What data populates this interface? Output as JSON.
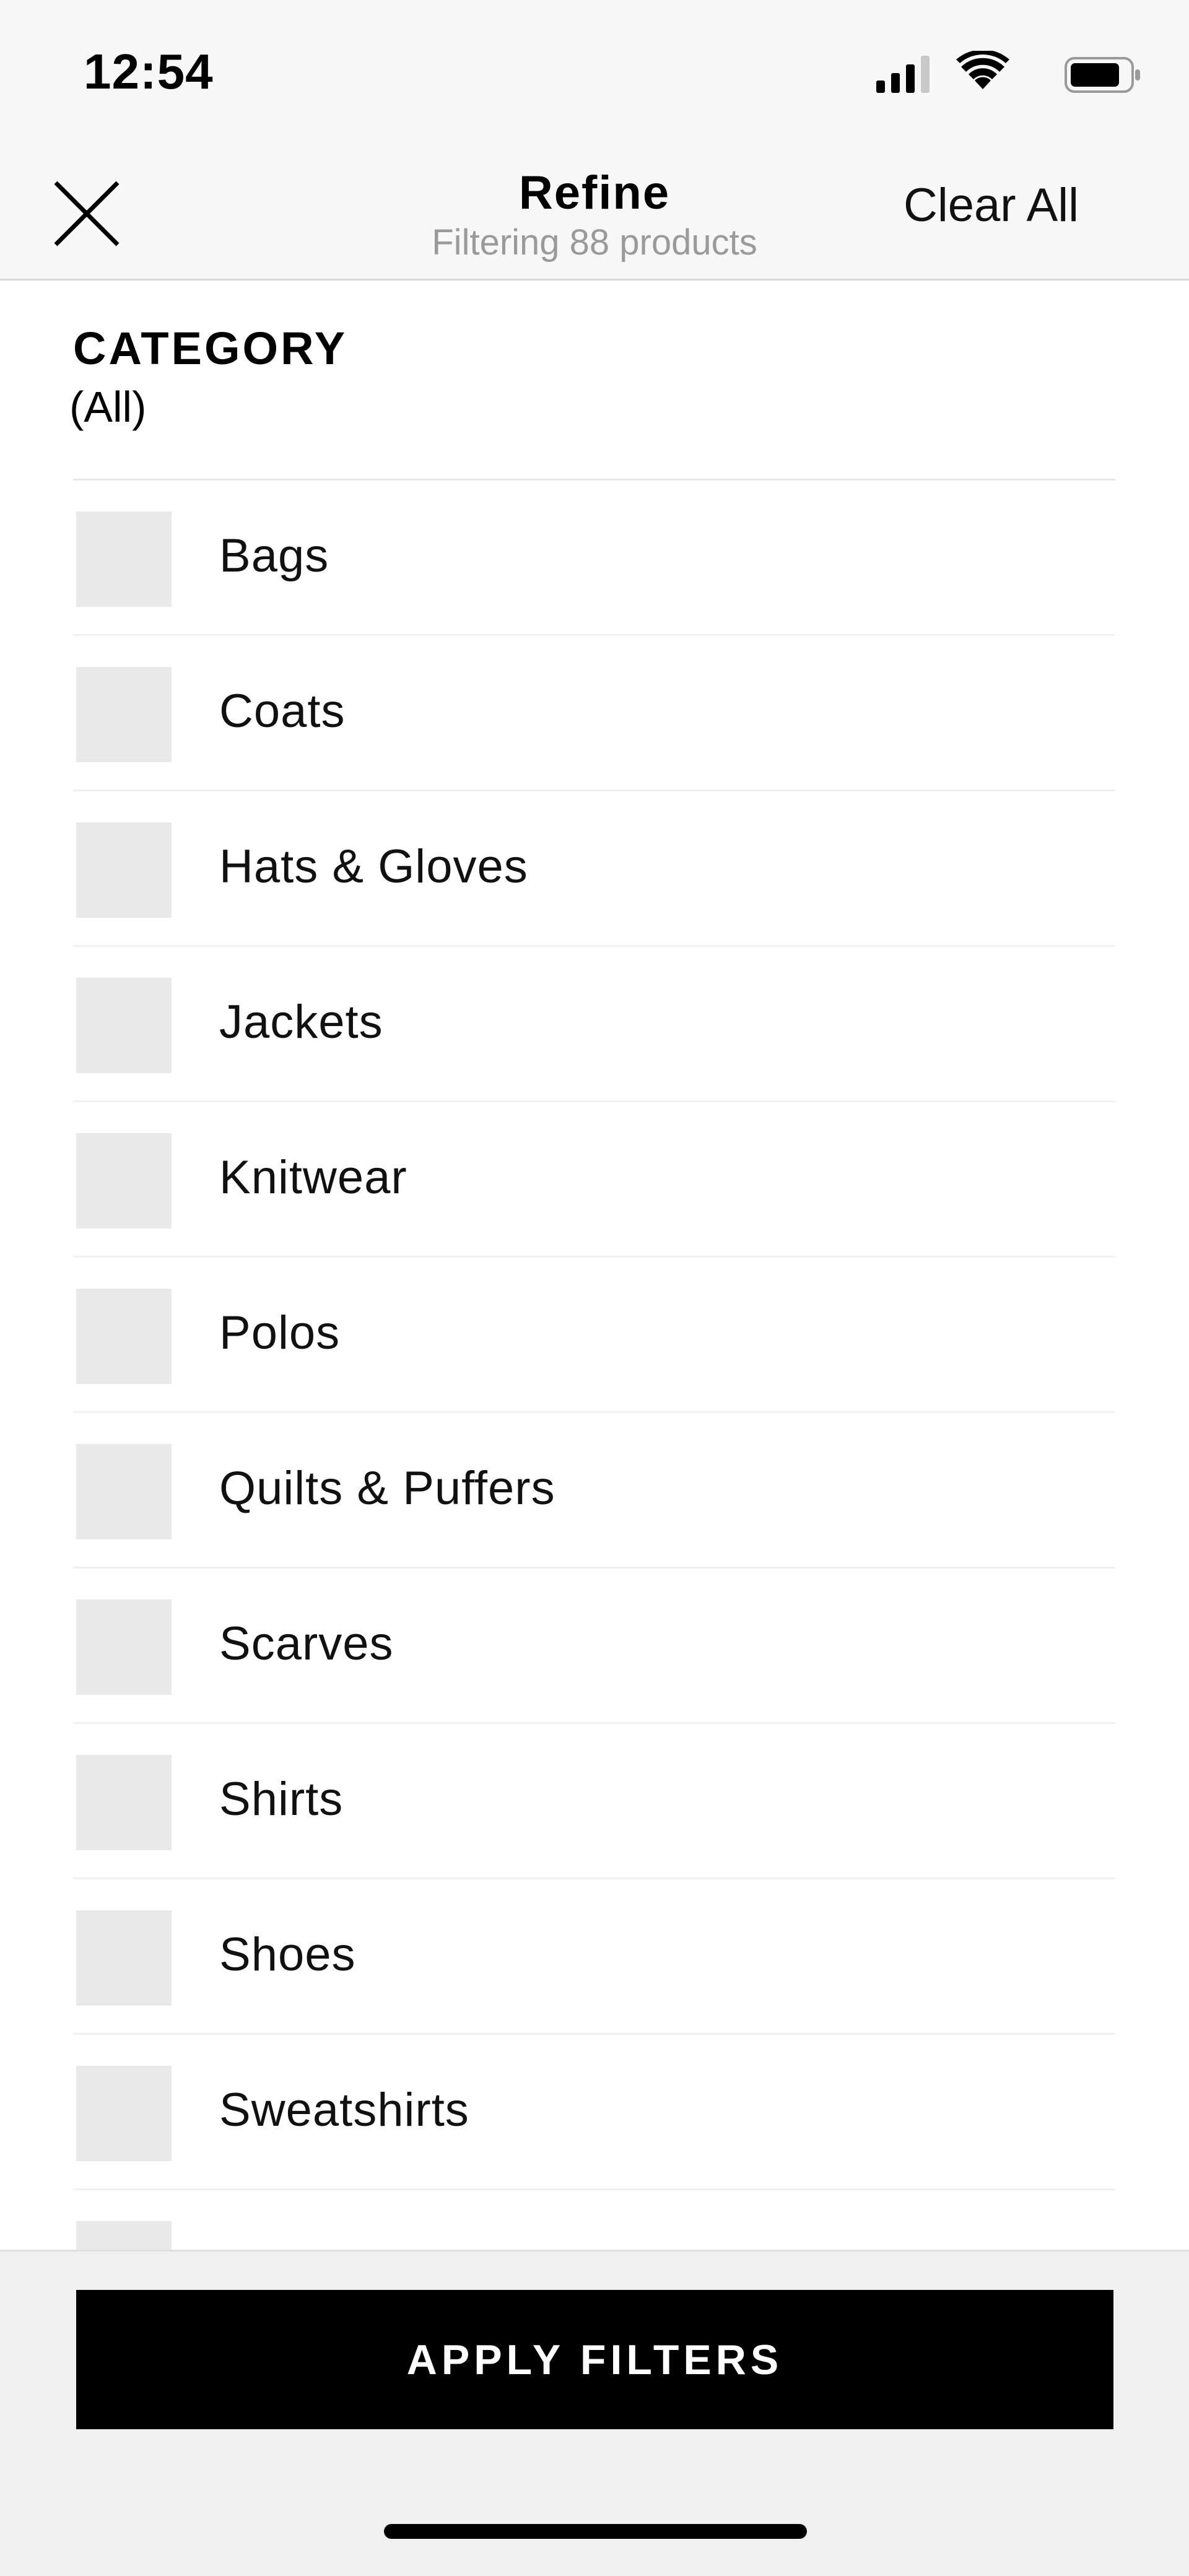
{
  "status_bar": {
    "time": "12:54",
    "icons": [
      "signal-icon",
      "wifi-icon",
      "battery-icon"
    ]
  },
  "header": {
    "close_icon": "close-icon",
    "title": "Refine",
    "subtitle": "Filtering 88 products",
    "clear_all_label": "Clear All"
  },
  "category": {
    "title": "CATEGORY",
    "selection": "(All)",
    "items": [
      {
        "label": "Bags",
        "checked": false
      },
      {
        "label": "Coats",
        "checked": false
      },
      {
        "label": "Hats & Gloves",
        "checked": false
      },
      {
        "label": "Jackets",
        "checked": false
      },
      {
        "label": "Knitwear",
        "checked": false
      },
      {
        "label": "Polos",
        "checked": false
      },
      {
        "label": "Quilts & Puffers",
        "checked": false
      },
      {
        "label": "Scarves",
        "checked": false
      },
      {
        "label": "Shirts",
        "checked": false
      },
      {
        "label": "Shoes",
        "checked": false
      },
      {
        "label": "Sweatshirts",
        "checked": false
      },
      {
        "label": "",
        "checked": false
      }
    ]
  },
  "footer": {
    "apply_label": "APPLY FILTERS"
  },
  "colors": {
    "background": "#ffffff",
    "header_background": "#f7f7f7",
    "checkbox_fill": "#e9e9e9",
    "apply_button": "#000000",
    "subtitle_text": "#9a9a9a"
  }
}
